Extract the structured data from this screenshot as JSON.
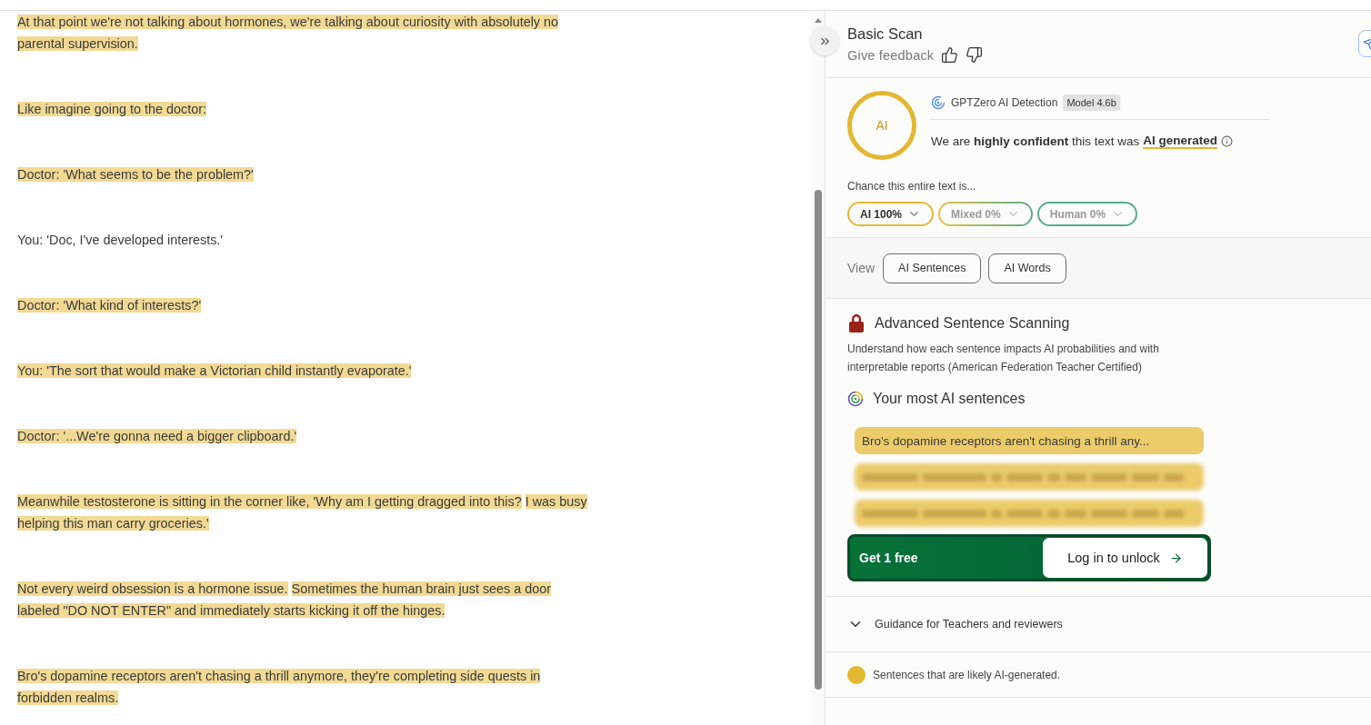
{
  "document": {
    "paragraphs": [
      {
        "lines": [
          [
            {
              "text": "At that point we're not talking about hormones, we're talking about curiosity with absolutely no",
              "highlighted": true
            }
          ],
          [
            {
              "text": "parental supervision.",
              "highlighted": true
            }
          ]
        ]
      },
      {
        "lines": [
          [
            {
              "text": "Like imagine going to the doctor:",
              "highlighted": true
            }
          ]
        ]
      },
      {
        "lines": [
          [
            {
              "text": "Doctor: 'What seems to be the problem?'",
              "highlighted": true
            }
          ]
        ]
      },
      {
        "lines": [
          [
            {
              "text": "You: 'Doc, I've developed interests.'",
              "highlighted": false
            }
          ]
        ]
      },
      {
        "lines": [
          [
            {
              "text": "Doctor: 'What kind of interests?'",
              "highlighted": true
            }
          ]
        ]
      },
      {
        "lines": [
          [
            {
              "text": "You: 'The sort that would make a Victorian child instantly evaporate.'",
              "highlighted": true
            }
          ]
        ]
      },
      {
        "lines": [
          [
            {
              "text": "Doctor: '...We're gonna need a bigger clipboard.'",
              "highlighted": true
            }
          ]
        ]
      },
      {
        "lines": [
          [
            {
              "text": "Meanwhile testosterone is sitting in the corner like, 'Why am I getting dragged into this?",
              "highlighted": true
            },
            {
              "text": "I was busy",
              "highlighted": true
            }
          ],
          [
            {
              "text": "helping this man carry groceries.'",
              "highlighted": true
            }
          ]
        ]
      },
      {
        "lines": [
          [
            {
              "text": "Not every weird obsession is a hormone issue.",
              "highlighted": true
            },
            {
              "text": "Sometimes the human brain just sees a door",
              "highlighted": true
            }
          ],
          [
            {
              "text": "labeled \"DO NOT ENTER\" and immediately starts kicking it off the hinges.",
              "highlighted": true
            }
          ]
        ]
      },
      {
        "lines": [
          [
            {
              "text": "Bro's dopamine receptors aren't chasing a thrill anymore, they're completing side quests in",
              "highlighted": true
            }
          ],
          [
            {
              "text": "forbidden realms.",
              "highlighted": true
            }
          ]
        ]
      }
    ]
  },
  "header": {
    "title": "Basic Scan",
    "feedback_label": "Give feedback"
  },
  "detection": {
    "result_label": "AI",
    "source": "GPTZero AI Detection",
    "model_badge": "Model 4.6b",
    "verdict": "We are **highly confident** this text was",
    "verdict_link": "AI generated",
    "chance_label": "Chance this entire text is...",
    "probabilities": [
      {
        "label": "AI 100%",
        "kind": "ai",
        "selected": true
      },
      {
        "label": "Mixed 0%",
        "kind": "mixed",
        "selected": false
      },
      {
        "label": "Human 0%",
        "kind": "human",
        "selected": false
      }
    ]
  },
  "view": {
    "label": "View",
    "options": [
      {
        "label": "AI Sentences"
      },
      {
        "label": "AI Words"
      }
    ]
  },
  "advanced": {
    "title": "Advanced Sentence Scanning",
    "description": "Understand how each sentence impacts AI probabilities and with interpretable reports (American Federation Teacher Certified)",
    "top_title": "Your most AI sentences",
    "sentences": [
      {
        "text": "Bro's dopamine receptors aren't chasing a thrill any...",
        "blurred": false
      },
      {
        "blurred": true
      },
      {
        "blurred": true
      }
    ],
    "cta": {
      "label": "Get 1 free",
      "button": "Log in to unlock"
    }
  },
  "guidance": {
    "label": "Guidance for Teachers and reviewers",
    "expanded": false
  },
  "legend": [
    {
      "label": "Sentences that are likely AI-generated.",
      "color": "#e3b732"
    }
  ]
}
